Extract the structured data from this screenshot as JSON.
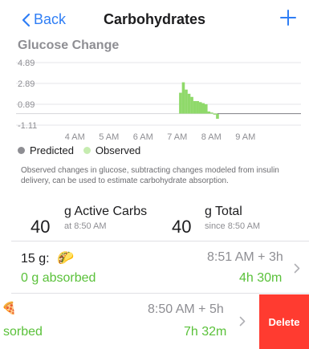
{
  "nav": {
    "back_label": "Back",
    "title": "Carbohydrates",
    "add_icon": "plus-icon",
    "back_icon": "chevron-left-icon"
  },
  "chart": {
    "title": "Glucose Change",
    "y_labels": [
      "4.89",
      "2.89",
      "0.89",
      "-1.11"
    ],
    "x_labels": [
      "4 AM",
      "5 AM",
      "6 AM",
      "7 AM",
      "8 AM",
      "9 AM"
    ],
    "colors": {
      "observed": "#8fd96a",
      "predicted": "#8e8e93",
      "observed_line": "#9fe07c"
    },
    "legend": {
      "predicted": "Predicted",
      "observed": "Observed"
    },
    "description": "Observed changes in glucose, subtracting changes modeled from insulin delivery, can be used to estimate carbohydrate absorption."
  },
  "chart_data": {
    "type": "bar",
    "title": "Glucose Change",
    "ylim": [
      -1.11,
      4.89
    ],
    "y_ticks": [
      4.89,
      2.89,
      0.89,
      -1.11
    ],
    "x_ticks": [
      "4 AM",
      "5 AM",
      "6 AM",
      "7 AM",
      "8 AM",
      "9 AM"
    ],
    "series": [
      {
        "name": "Observed",
        "x": [
          "7:50",
          "7:55",
          "8:00",
          "8:05",
          "8:10",
          "8:15",
          "8:20",
          "8:25",
          "8:30",
          "8:35",
          "8:40",
          "8:45",
          "8:50",
          "8:55"
        ],
        "values": [
          2.0,
          3.0,
          2.3,
          1.9,
          1.6,
          1.2,
          1.2,
          1.1,
          1.0,
          0.9,
          0.2,
          0.1,
          -0.1,
          -0.5
        ]
      }
    ]
  },
  "active_carbs": {
    "value": "40",
    "label": "g Active Carbs",
    "sub": "at 8:50 AM"
  },
  "total": {
    "value": "40",
    "label": "g Total",
    "sub": "since 8:50 AM"
  },
  "entries": [
    {
      "amount": "15 g:",
      "emoji": "🌮",
      "time": "8:51 AM + 3h",
      "absorbed": "0 g absorbed",
      "duration": "4h 30m"
    },
    {
      "emoji": "🍕",
      "time": "8:50 AM + 5h",
      "absorbed": "sorbed",
      "duration": "7h 32m",
      "delete_label": "Delete"
    }
  ]
}
